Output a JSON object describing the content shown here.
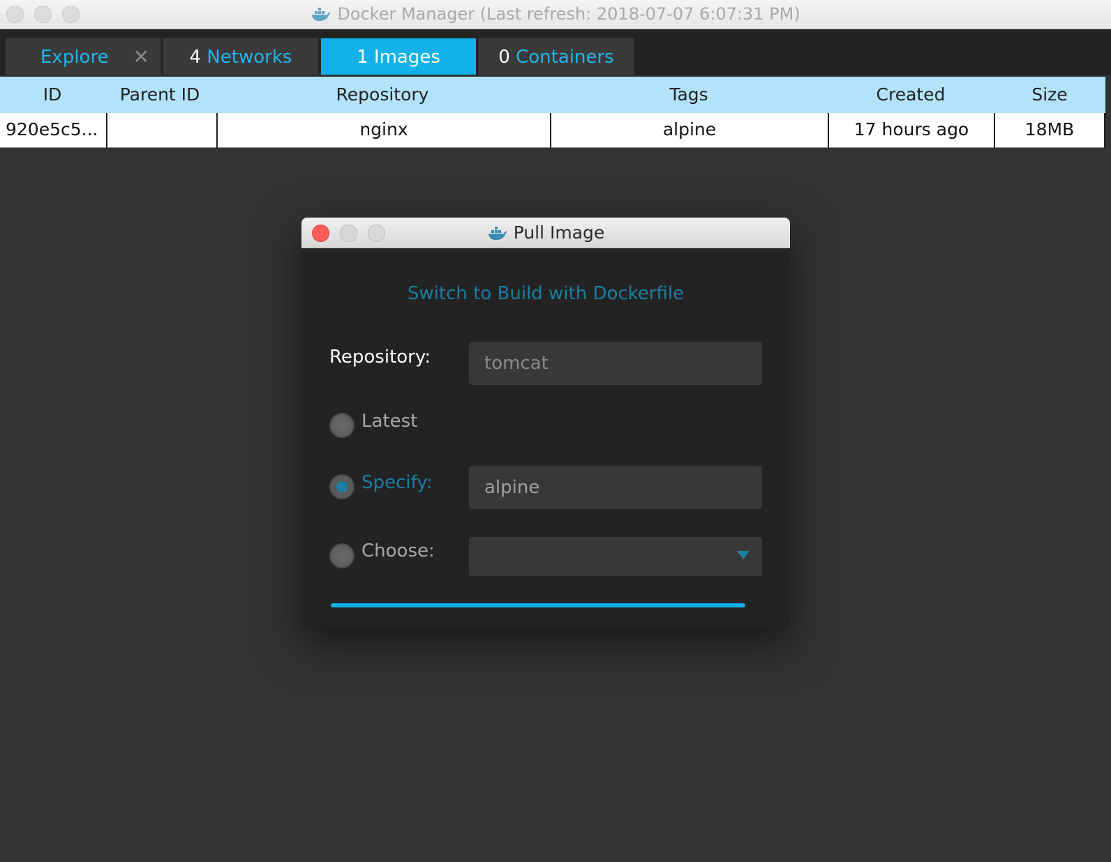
{
  "window": {
    "title": "Docker Manager (Last refresh: 2018-07-07 6:07:31 PM)"
  },
  "tabs": [
    {
      "num": "",
      "word": "Explore",
      "active": false,
      "closable": true
    },
    {
      "num": "4",
      "word": "Networks",
      "active": false
    },
    {
      "num": "1",
      "word": "Images",
      "active": true
    },
    {
      "num": "0",
      "word": "Containers",
      "active": false
    }
  ],
  "table": {
    "columns": [
      "ID",
      "Parent ID",
      "Repository",
      "Tags",
      "Created",
      "Size"
    ],
    "rows": [
      [
        "920e5c5...",
        "",
        "nginx",
        "alpine",
        "17 hours ago",
        "18MB"
      ]
    ]
  },
  "dialog": {
    "title": "Pull Image",
    "switch_link": "Switch to Build with Dockerfile",
    "repository_label": "Repository:",
    "repository_placeholder": "tomcat",
    "latest_label": "Latest",
    "specify_label": "Specify:",
    "specify_value": "alpine",
    "choose_label": "Choose:",
    "choose_value": "",
    "selected_option": "specify",
    "progress": 1.0
  },
  "colors": {
    "accent": "#12b2e8",
    "link": "#1b7ea3",
    "table_header": "#b2e3fb",
    "close_red": "#fc5b57"
  }
}
